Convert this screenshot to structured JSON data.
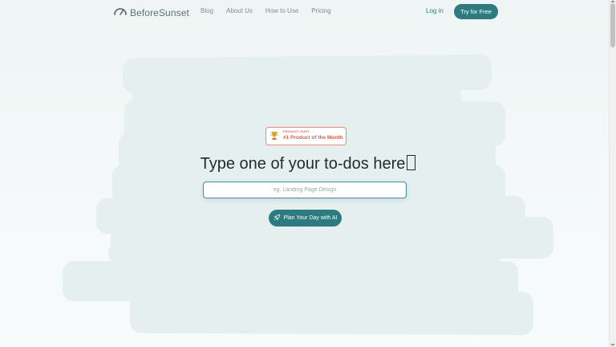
{
  "header": {
    "logo_text": "BeforeSunset",
    "nav": [
      "Blog",
      "About Us",
      "How to Use",
      "Pricing"
    ],
    "login_label": "Log in",
    "cta_label": "Try for Free"
  },
  "hero": {
    "badge_small": "PRODUCT HUNT",
    "badge_big": "#1 Product of the Month",
    "headline": "Type one of your to-dos here",
    "input_placeholder": "eg. Landing Page Design",
    "button_label": "Plan Your Day with AI"
  },
  "colors": {
    "accent": "#2d7b81",
    "badge": "#e05a4a",
    "background": "#eef5f4"
  },
  "icons": {
    "logo": "gauge-icon",
    "badge": "trophy-icon",
    "button": "rocket-icon"
  }
}
